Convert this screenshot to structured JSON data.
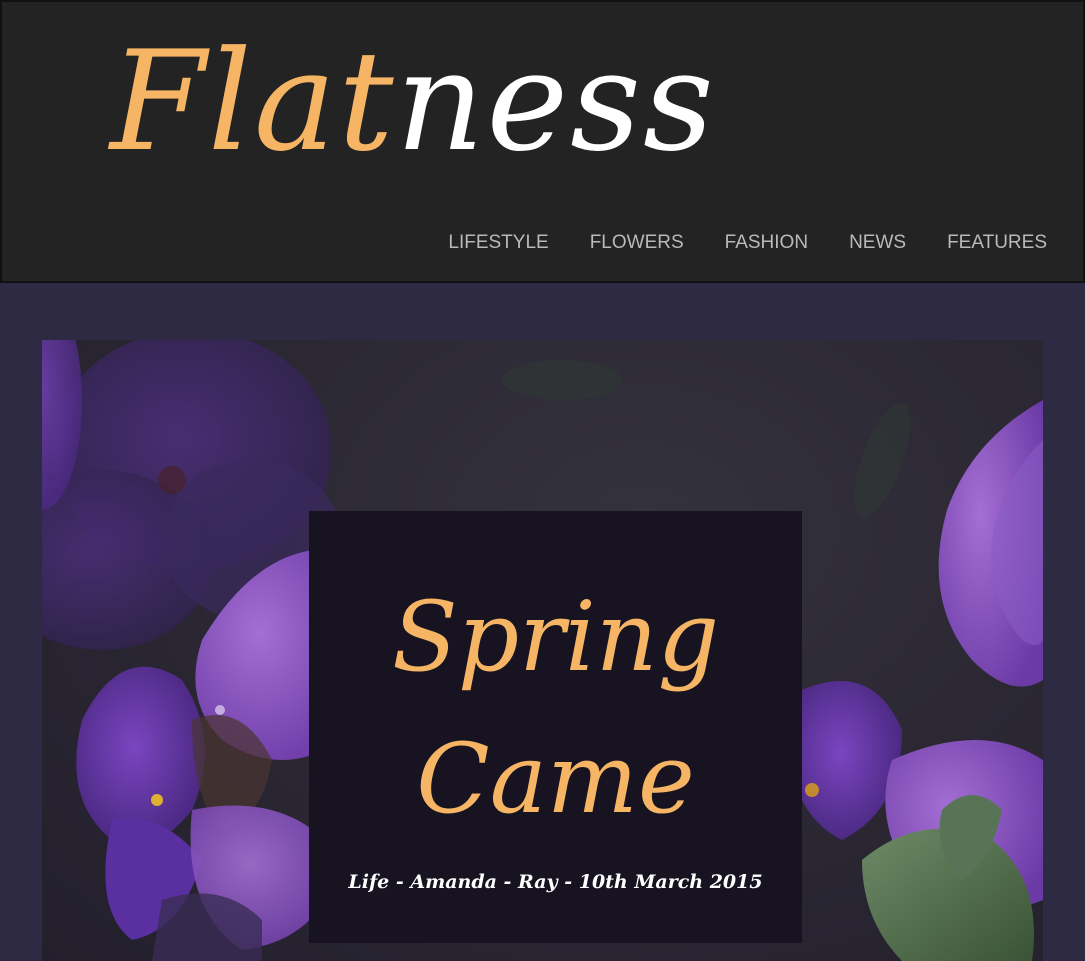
{
  "logo": {
    "accent": "Flat",
    "rest": "ness"
  },
  "nav": {
    "items": [
      {
        "label": "LIFESTYLE"
      },
      {
        "label": "FLOWERS"
      },
      {
        "label": "FASHION"
      },
      {
        "label": "NEWS"
      },
      {
        "label": "FEATURES"
      }
    ]
  },
  "feature": {
    "title_line1": "Spring",
    "title_line2": "Came",
    "meta": "Life - Amanda - Ray - 10th March 2015"
  },
  "colors": {
    "header_bg": "#232323",
    "accent": "#f5b565",
    "page_bg": "#2f2a44",
    "feature_bg": "#171321",
    "nav_text": "#b9b9b9"
  }
}
